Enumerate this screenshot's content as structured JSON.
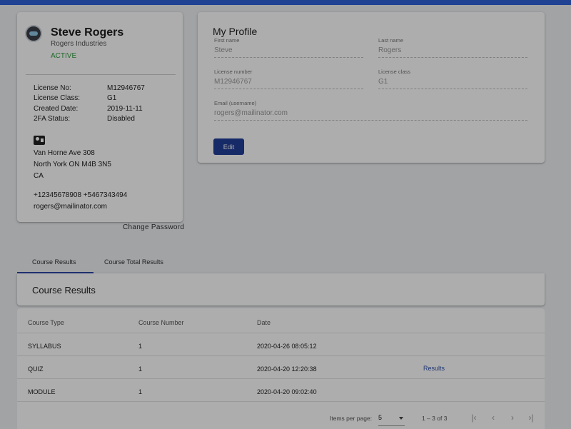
{
  "summary": {
    "name": "Steve Rogers",
    "company": "Rogers Industries",
    "status": "ACTIVE",
    "info": [
      {
        "label": "License No:",
        "value": "M12946767"
      },
      {
        "label": "License Class:",
        "value": "G1"
      },
      {
        "label": "Created Date:",
        "value": "2019-11-11"
      },
      {
        "label": "2FA Status:",
        "value": "Disabled"
      }
    ],
    "address_lines": [
      "Van Horne Ave 308",
      "North York ON M4B 3N5",
      "CA"
    ],
    "phones": "+12345678908 +5467343494",
    "email": "rogers@mailinator.com",
    "contact_icon": "contact-card-icon",
    "avatar_icon": "avatar-icon"
  },
  "change_password_label": "Change Password",
  "my_profile": {
    "title": "My Profile",
    "fields": {
      "first_name": {
        "label": "First name",
        "value": "Steve"
      },
      "last_name": {
        "label": "Last name",
        "value": "Rogers"
      },
      "license_number": {
        "label": "License number",
        "value": "M12946767"
      },
      "license_class": {
        "label": "License class",
        "value": "G1"
      },
      "email": {
        "label": "Email (username)",
        "value": "rogers@mailinator.com"
      }
    },
    "edit_label": "Edit"
  },
  "tabs": [
    {
      "label": "Course Results",
      "active": true
    },
    {
      "label": "Course Total Results",
      "active": false
    }
  ],
  "course_results": {
    "title": "Course Results",
    "columns": [
      "Course Type",
      "Course Number",
      "Date"
    ],
    "rows": [
      {
        "type": "SYLLABUS",
        "number": "1",
        "date": "2020-04-26 08:05:12",
        "action": ""
      },
      {
        "type": "QUIZ",
        "number": "1",
        "date": "2020-04-20 12:20:38",
        "action": "Results"
      },
      {
        "type": "MODULE",
        "number": "1",
        "date": "2020-04-20 09:02:40",
        "action": ""
      }
    ],
    "paginator": {
      "items_per_page_label": "Items per page:",
      "page_size": "5",
      "range": "1 – 3 of 3"
    }
  },
  "colors": {
    "topbar": "#2f62d8",
    "active_status": "#2e9d3c",
    "primary_button": "#223f9a",
    "link": "#2d4fa8"
  }
}
